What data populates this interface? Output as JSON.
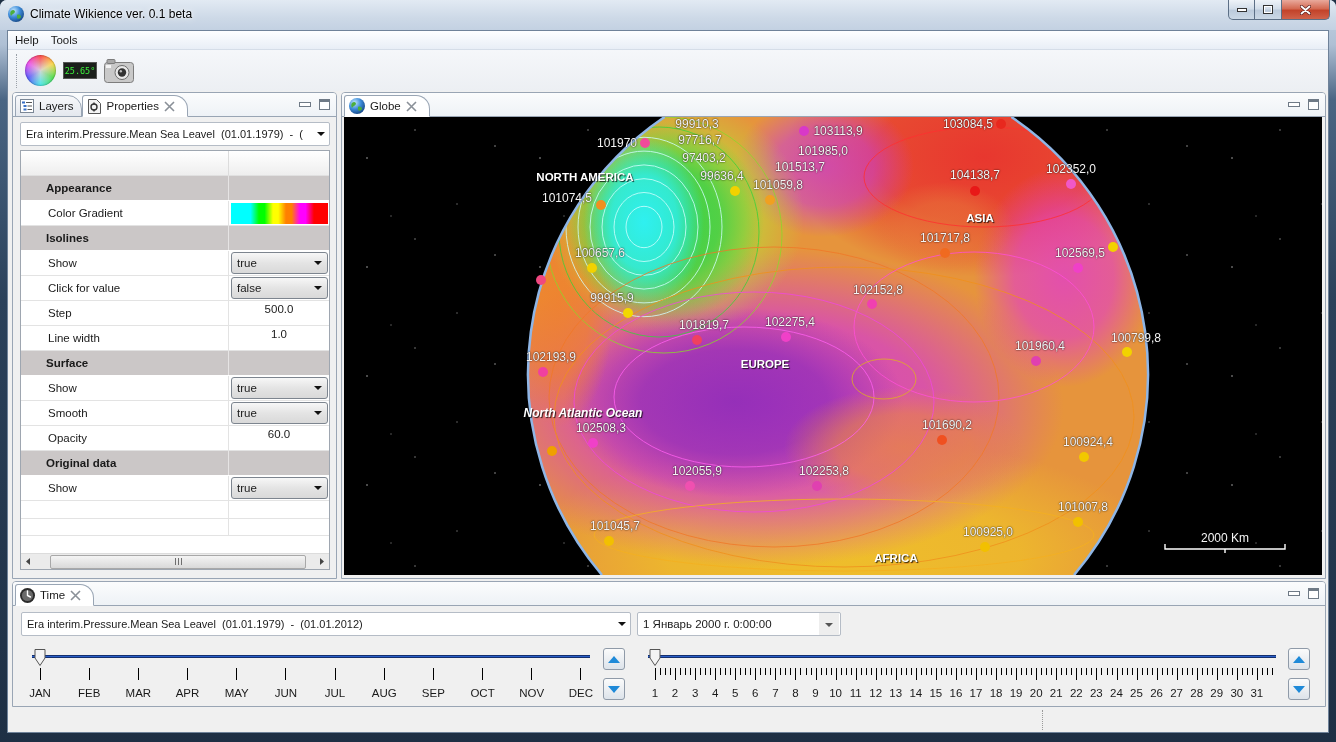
{
  "window": {
    "title": "Climate Wikience ver. 0.1 beta"
  },
  "menu": [
    {
      "label": "Help"
    },
    {
      "label": "Tools"
    }
  ],
  "toolbar": {
    "temperature": "25.65°"
  },
  "properties_view": {
    "tabs": [
      {
        "label": "Layers",
        "selected": false
      },
      {
        "label": "Properties",
        "selected": true
      }
    ],
    "layer": "Era interim.Pressure.Mean Sea Leavel  (01.01.1979)  -  (",
    "rows": [
      {
        "kind": "category",
        "label": "Appearance"
      },
      {
        "kind": "gradient",
        "label": "Color Gradient",
        "stops": [
          {
            "color": "#00ffff"
          },
          {
            "color": "#00ffff"
          },
          {
            "color": "#00ff00"
          },
          {
            "color": "#ffff00"
          },
          {
            "color": "#ff8000"
          },
          {
            "color": "#ff00ff"
          },
          {
            "color": "#ff0000"
          }
        ]
      },
      {
        "kind": "category",
        "label": "Isolines"
      },
      {
        "kind": "choice",
        "label": "Show",
        "value": "true"
      },
      {
        "kind": "choice",
        "label": "Click for value",
        "value": "false"
      },
      {
        "kind": "number",
        "label": "Step",
        "value": "500.0"
      },
      {
        "kind": "number",
        "label": "Line width",
        "value": "1.0"
      },
      {
        "kind": "category",
        "label": "Surface"
      },
      {
        "kind": "choice",
        "label": "Show",
        "value": "true"
      },
      {
        "kind": "choice",
        "label": "Smooth",
        "value": "true"
      },
      {
        "kind": "number",
        "label": "Opacity",
        "value": "60.0"
      },
      {
        "kind": "category",
        "label": "Original data"
      },
      {
        "kind": "choice",
        "label": "Show",
        "value": "true"
      }
    ]
  },
  "globe_view": {
    "tabs": [
      {
        "label": "Globe",
        "selected": true
      }
    ],
    "stations": [
      {
        "value": "99910,3"
      },
      {
        "value": "103084,5",
        "color": "#e8281e"
      },
      {
        "value": "103113,9",
        "color": "#d838c8"
      },
      {
        "value": "101970",
        "color": "#f04a9a"
      },
      {
        "value": "97716,7"
      },
      {
        "value": "101985,0"
      },
      {
        "value": "97403,2"
      },
      {
        "value": "101513,7"
      },
      {
        "value": "102352,0",
        "color": "#f058c8"
      },
      {
        "value": "99636,4",
        "color": "#f2d200"
      },
      {
        "value": "104138,7",
        "color": "#e81818"
      },
      {
        "value": "101059,8",
        "color": "#f0a020"
      },
      {
        "value": "101074,5",
        "color": "#f09020"
      },
      {
        "value": "101717,8",
        "color": "#f06a20"
      },
      {
        "color": "#f2d200"
      },
      {
        "value": "100657,6",
        "color": "#f2d200"
      },
      {
        "value": "102569,5",
        "color": "#f040c8"
      },
      {
        "color": "#f04880"
      },
      {
        "value": "102152,8",
        "color": "#f040b0"
      },
      {
        "value": "99915,9",
        "color": "#f2d800"
      },
      {
        "value": "102275,4",
        "color": "#f040c8"
      },
      {
        "value": "101819,7",
        "color": "#f04060"
      },
      {
        "value": "100799,8",
        "color": "#f2d200"
      },
      {
        "value": "101960,4",
        "color": "#e040b0"
      },
      {
        "value": "102193,9",
        "color": "#f040a0"
      },
      {
        "value": "101690,2",
        "color": "#f05020"
      },
      {
        "value": "102508,3",
        "color": "#f040c8"
      },
      {
        "value": "100924,4",
        "color": "#f2c800"
      },
      {
        "color": "#f0a000"
      },
      {
        "value": "102055,9",
        "color": "#f050b0"
      },
      {
        "value": "102253,8",
        "color": "#e040b0"
      },
      {
        "value": "101007,8",
        "color": "#f2c000"
      },
      {
        "value": "101045,7",
        "color": "#f2c000"
      },
      {
        "value": "100925,0",
        "color": "#f2c000"
      }
    ],
    "places": [
      {
        "kind": "continent",
        "name": "NORTH AMERICA"
      },
      {
        "kind": "continent",
        "name": "ASIA"
      },
      {
        "kind": "continent",
        "name": "EUROPE"
      },
      {
        "kind": "ocean",
        "name": "North Atlantic Ocean"
      },
      {
        "kind": "continent",
        "name": "AFRICA"
      }
    ],
    "scale_bar": "2000 Km"
  },
  "time_view": {
    "tabs": [
      {
        "label": "Time",
        "selected": true
      }
    ],
    "dataset": "Era interim.Pressure.Mean Sea Leavel  (01.01.1979)  -  (01.01.2012)",
    "date": "1 Январь 2000 г. 0:00:00",
    "month_slider": {
      "level": 0,
      "labels": [
        "JAN",
        "FEB",
        "MAR",
        "APR",
        "MAY",
        "JUN",
        "JUL",
        "AUG",
        "SEP",
        "OCT",
        "NOV",
        "DEC"
      ]
    },
    "day_slider": {
      "level": 0,
      "labels": [
        "1",
        "2",
        "3",
        "4",
        "5",
        "6",
        "7",
        "8",
        "9",
        "10",
        "11",
        "12",
        "13",
        "14",
        "15",
        "16",
        "17",
        "18",
        "19",
        "20",
        "21",
        "22",
        "23",
        "24",
        "25",
        "26",
        "27",
        "28",
        "29",
        "30",
        "31"
      ]
    }
  }
}
